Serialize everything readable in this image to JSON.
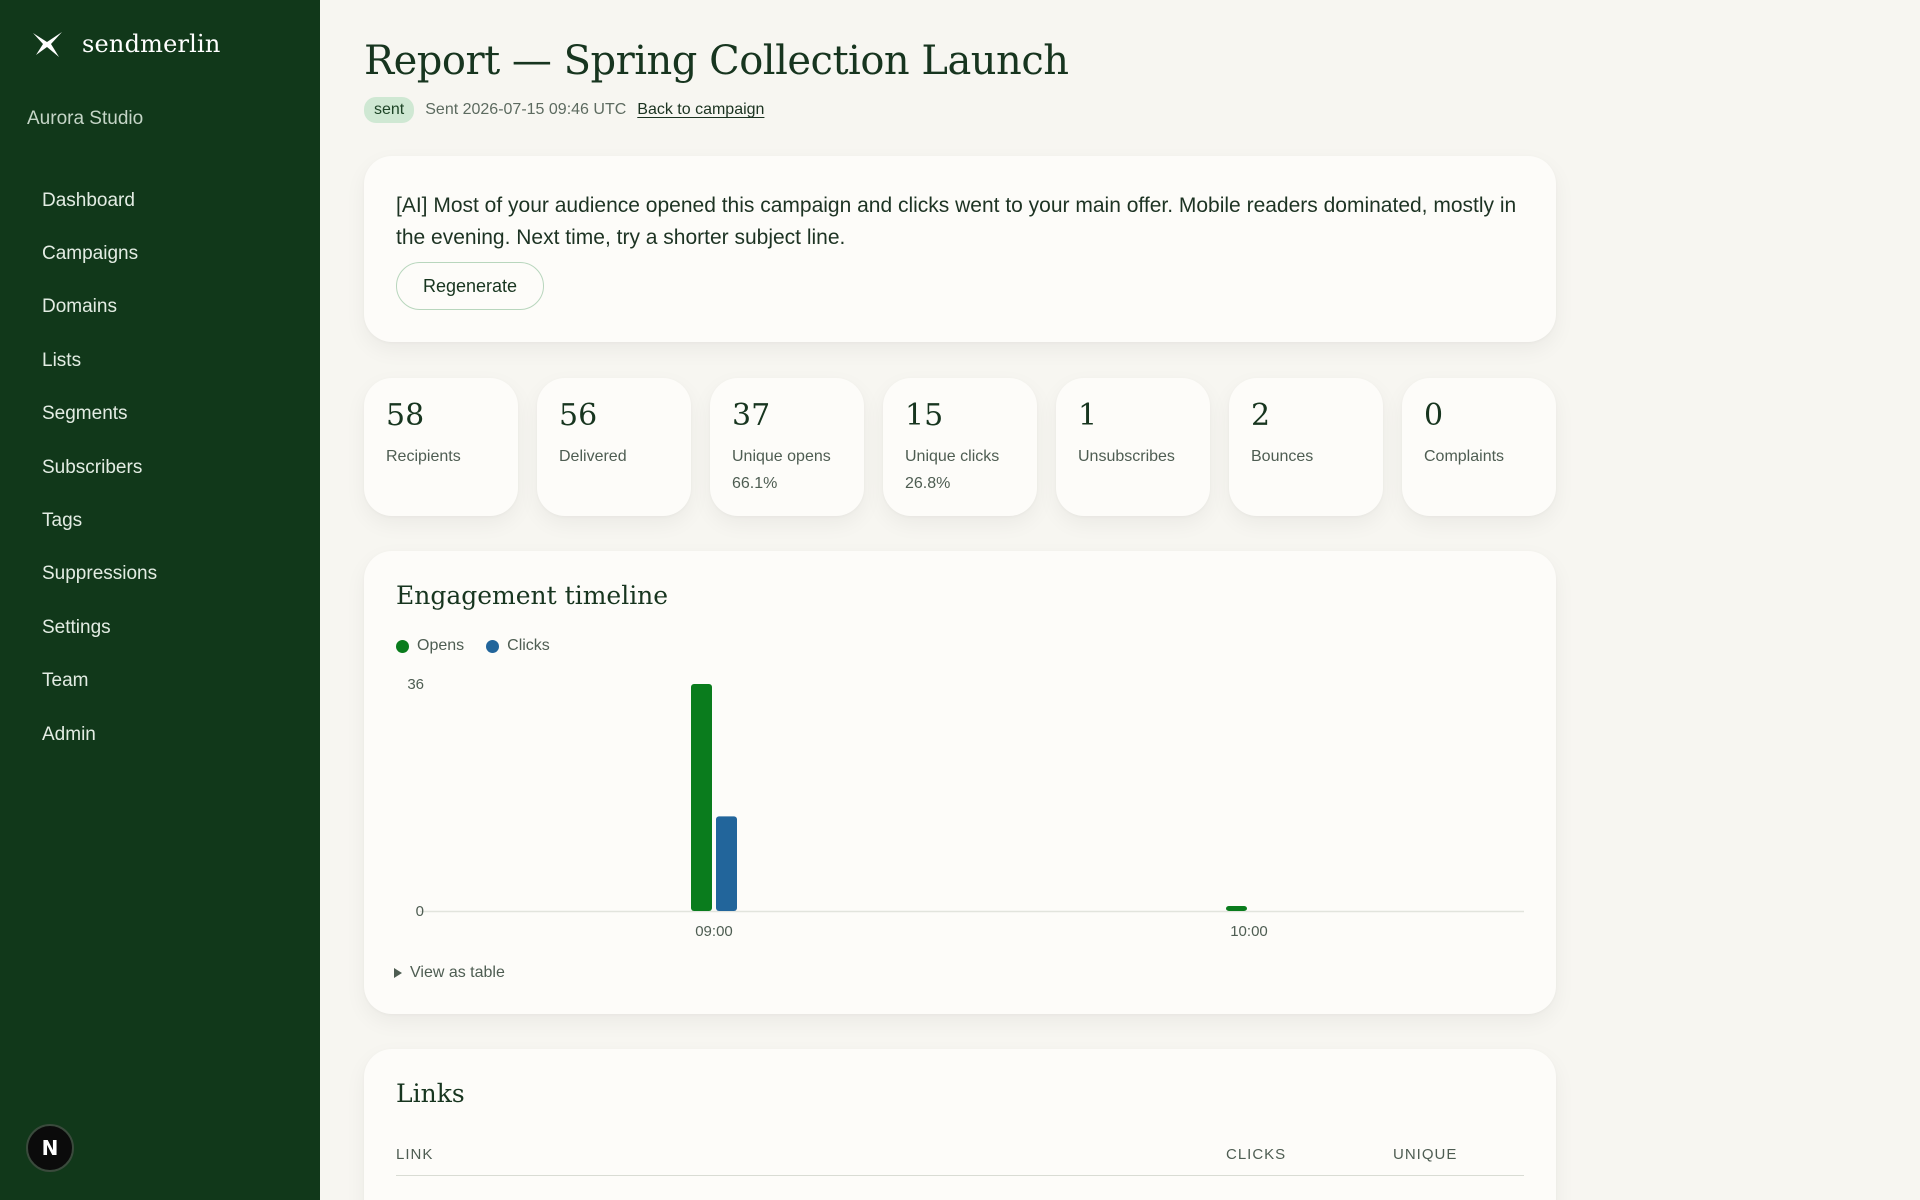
{
  "app": {
    "brand": "sendmerlin",
    "org": "Aurora Studio",
    "avatar_letter": "N"
  },
  "sidebar": {
    "items": [
      {
        "label": "Dashboard"
      },
      {
        "label": "Campaigns"
      },
      {
        "label": "Domains"
      },
      {
        "label": "Lists"
      },
      {
        "label": "Segments"
      },
      {
        "label": "Subscribers"
      },
      {
        "label": "Tags"
      },
      {
        "label": "Suppressions"
      },
      {
        "label": "Settings"
      },
      {
        "label": "Team"
      },
      {
        "label": "Admin"
      }
    ]
  },
  "report": {
    "title": "Report — Spring Collection Launch",
    "status": "sent",
    "sent_text": "Sent 2026-07-15 09:46 UTC",
    "back_link": "Back to campaign"
  },
  "ai_summary": {
    "text": "[AI] Most of your audience opened this campaign and clicks went to your main offer. Mobile readers dominated, mostly in the evening. Next time, try a shorter subject line.",
    "regenerate_label": "Regenerate"
  },
  "stats": [
    {
      "value": "58",
      "label": "Recipients",
      "sub": ""
    },
    {
      "value": "56",
      "label": "Delivered",
      "sub": ""
    },
    {
      "value": "37",
      "label": "Unique opens",
      "sub": "66.1%"
    },
    {
      "value": "15",
      "label": "Unique clicks",
      "sub": "26.8%"
    },
    {
      "value": "1",
      "label": "Unsubscribes",
      "sub": ""
    },
    {
      "value": "2",
      "label": "Bounces",
      "sub": ""
    },
    {
      "value": "0",
      "label": "Complaints",
      "sub": ""
    }
  ],
  "engagement": {
    "title": "Engagement timeline",
    "view_table_label": "View as table"
  },
  "chart_data": {
    "type": "bar",
    "categories": [
      "09:00",
      "10:00"
    ],
    "series": [
      {
        "name": "Opens",
        "values": [
          36,
          0.5
        ],
        "color": "#0a7c1d"
      },
      {
        "name": "Clicks",
        "values": [
          15,
          0
        ],
        "color": "#22659b"
      }
    ],
    "ylim": [
      0,
      36
    ],
    "y_ticks": [
      "0",
      "36"
    ],
    "grid": false,
    "legend": "top-left"
  },
  "links": {
    "title": "Links",
    "columns": {
      "link": "LINK",
      "clicks": "CLICKS",
      "unique": "UNIQUE"
    }
  },
  "colors": {
    "sidebar_bg": "#11381a",
    "page_bg": "#f7f6f1",
    "badge_bg": "#cfe8d3",
    "opens": "#0a7c1d",
    "clicks": "#22659b"
  }
}
